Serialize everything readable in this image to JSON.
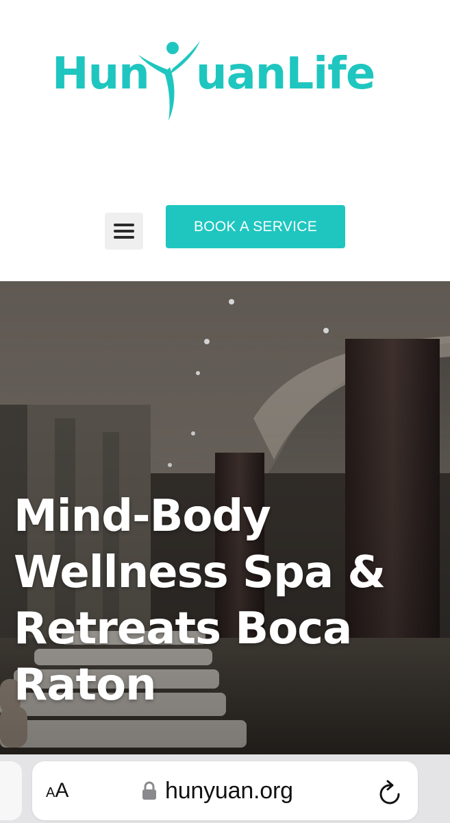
{
  "colors": {
    "brand": "#1fc6c0",
    "hero_overlay": "#000000",
    "browser_bar": "#e4e4e6"
  },
  "header": {
    "logo": {
      "text_left": "Hun",
      "text_right": "uanLife",
      "figure_icon": "person-y-figure"
    },
    "menu_button_icon": "hamburger-menu-icon",
    "book_button_label": "BOOK A SERVICE"
  },
  "hero": {
    "title": "Mind-Body Wellness Spa & Retreats Boca Raton",
    "background": "spa-pool-lounge-photo"
  },
  "browser": {
    "text_size_small": "A",
    "text_size_big": "A",
    "lock_icon": "lock-icon",
    "url": "hunyuan.org",
    "reload_icon": "reload-icon"
  }
}
